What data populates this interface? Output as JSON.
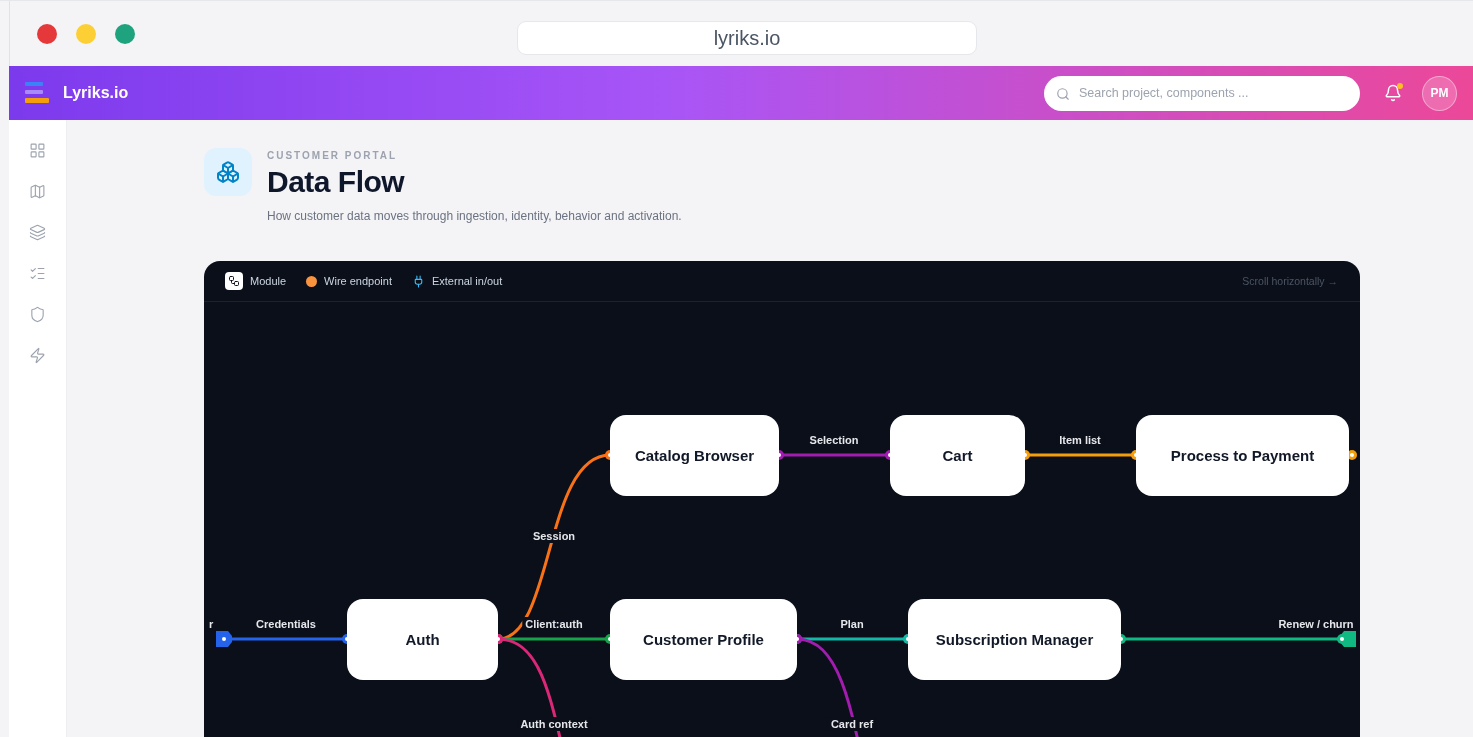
{
  "browser": {
    "url": "lyriks.io"
  },
  "app": {
    "brand": "Lyriks.io",
    "search": {
      "placeholder": "Search project, components ..."
    },
    "notifications": {
      "unread": true
    },
    "avatar": "PM"
  },
  "page": {
    "eyebrow": "CUSTOMER PORTAL",
    "title": "Data Flow",
    "subtitle": "How customer data moves through ingestion, identity, behavior and activation."
  },
  "canvas": {
    "legend": [
      {
        "kind": "module",
        "label": "Module"
      },
      {
        "kind": "endpoint",
        "label": "Wire endpoint"
      },
      {
        "kind": "external",
        "label": "External in/out"
      }
    ],
    "hint": "Scroll horizontally →",
    "cut_label": "r",
    "nodes": [
      {
        "label": "Catalog Browser"
      },
      {
        "label": "Cart"
      },
      {
        "label": "Process to Payment"
      },
      {
        "label": "Auth"
      },
      {
        "label": "Customer Profile"
      },
      {
        "label": "Subscription Manager"
      }
    ],
    "edges": [
      {
        "label": "Credentials",
        "color": "#2563eb",
        "kind": "external"
      },
      {
        "label": "Session",
        "color": "#f97316",
        "kind": "internal"
      },
      {
        "label": "Client:auth",
        "color": "#16a34a",
        "kind": "internal"
      },
      {
        "label": "Auth context",
        "color": "#db2777",
        "kind": "internal"
      },
      {
        "label": "Selection",
        "color": "#a21caf",
        "kind": "internal"
      },
      {
        "label": "Item list",
        "color": "#f59e0b",
        "kind": "internal"
      },
      {
        "color": "#f59e0b",
        "kind": "stub"
      },
      {
        "label": "Plan",
        "color": "#14b8a6",
        "kind": "internal"
      },
      {
        "label": "Card ref",
        "color": "#a21caf",
        "kind": "internal"
      },
      {
        "label": "Renew / churn",
        "color": "#10b981",
        "kind": "external"
      }
    ]
  }
}
